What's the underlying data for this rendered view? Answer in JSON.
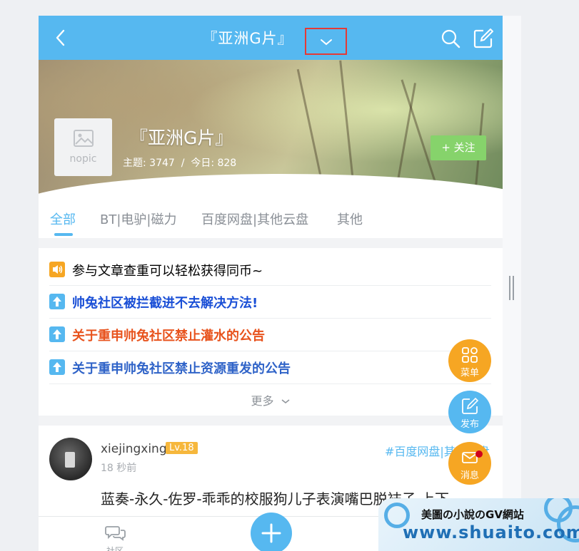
{
  "header": {
    "title": "『亚洲G片』",
    "back_icon": "back-arrow-icon",
    "dropdown_icon": "chevron-down-icon",
    "search_icon": "search-icon",
    "edit_icon": "edit-icon"
  },
  "forum": {
    "nopic_label": "nopic",
    "name": "『亚洲G片』",
    "stats": "主题: 3747  /  今日: 828",
    "follow_label": "+ 关注"
  },
  "tabs": [
    {
      "label": "全部",
      "active": true
    },
    {
      "label": "BT|电驴|磁力",
      "active": false
    },
    {
      "label": "百度网盘|其他云盘",
      "active": false
    },
    {
      "label": "其他",
      "active": false
    }
  ],
  "notices": [
    {
      "text": "参与文章查重可以轻松获得同币~",
      "color": "#333333",
      "icon": "speaker-icon"
    },
    {
      "text": "帅兔社区被拦截进不去解决方法!",
      "color": "#1a4fd6",
      "icon": "pin-up-icon"
    },
    {
      "text": "关于重申帅兔社区禁止灌水的公告",
      "color": "#e8531d",
      "icon": "pin-up-icon"
    },
    {
      "text": "关于重申帅兔社区禁止资源重发的公告",
      "color": "#2f63c8",
      "icon": "pin-up-icon"
    }
  ],
  "more_label": "更多",
  "post": {
    "username": "xiejingxing",
    "level": "Lv.18",
    "time": "18 秒前",
    "tag": "#百度网盘|其他云盘",
    "title": "蓝奏-永久-佐罗-乖乖的校服狗儿子表演嘴巴脱袜子 上下"
  },
  "fabs": {
    "menu_label": "菜单",
    "publish_label": "发布",
    "message_label": "消息"
  },
  "bottom_nav": {
    "community_label": "社区"
  },
  "watermark": {
    "line1": "美圖の小說のGV網站",
    "line2": "www.shuaito.com"
  },
  "colors": {
    "primary": "#56b8f0",
    "follow": "#86d36b",
    "fab_orange": "#f6a623",
    "level_badge": "#f6b73c"
  }
}
